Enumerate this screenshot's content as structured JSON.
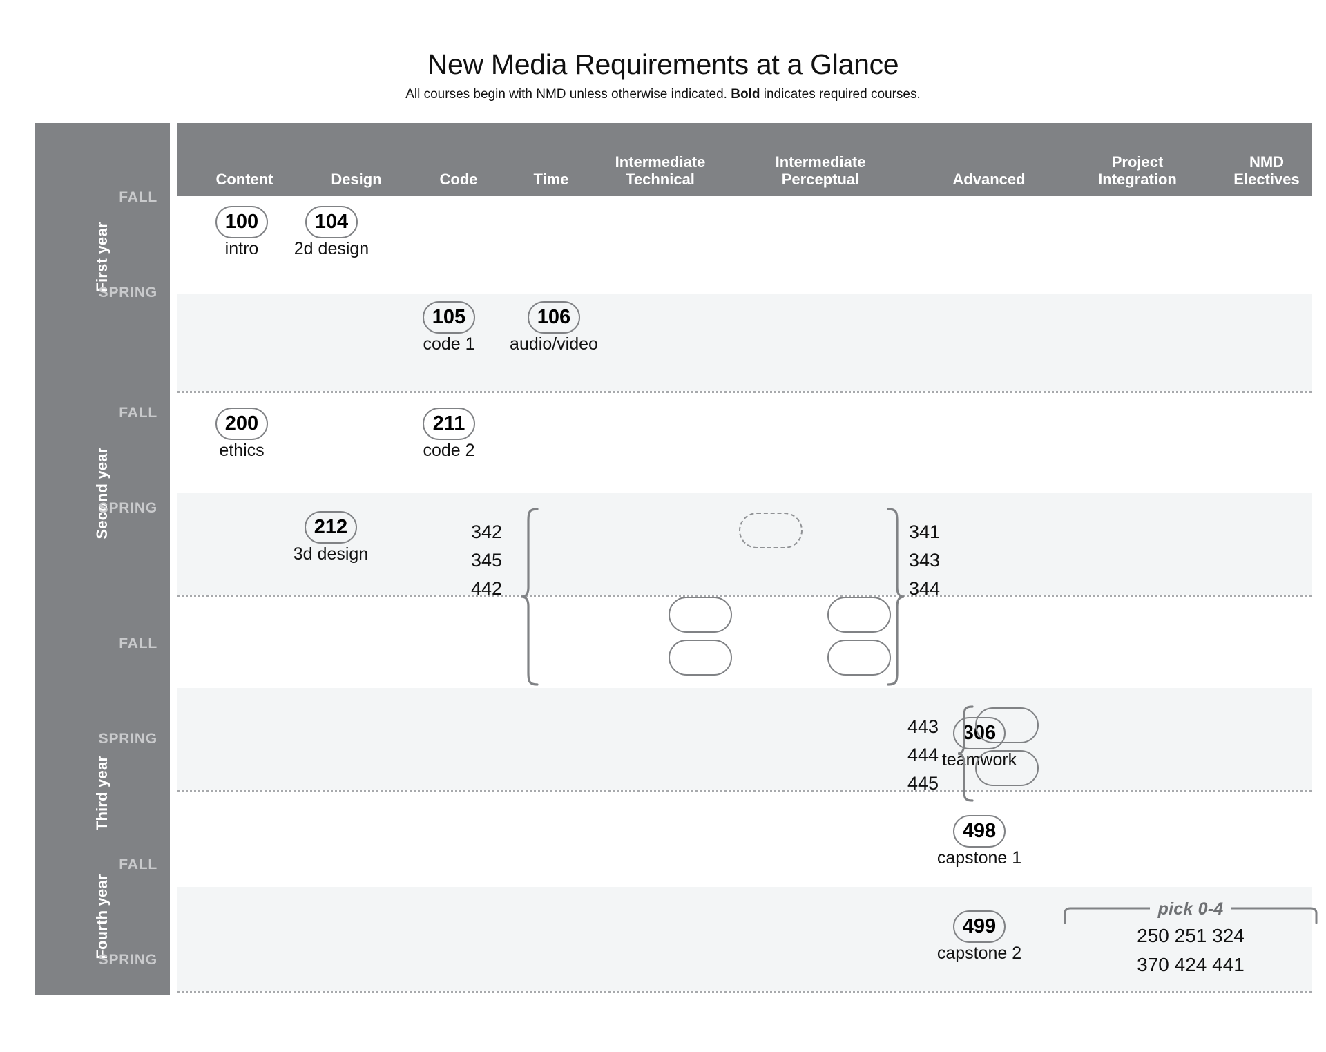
{
  "header": {
    "title": "New Media Requirements at a Glance",
    "subtitle_pre": "All courses begin with NMD unless otherwise indicated. ",
    "subtitle_bold": "Bold",
    "subtitle_post": " indicates required courses."
  },
  "colors": {
    "band_gray": "#808285",
    "alt_row": "#f3f5f6",
    "term_label": "#c9cacc",
    "outline": "#808285"
  },
  "columns": [
    {
      "id": "content",
      "label": "Content"
    },
    {
      "id": "design",
      "label": "Design"
    },
    {
      "id": "code",
      "label": "Code"
    },
    {
      "id": "time",
      "label": "Time"
    },
    {
      "id": "int_tech",
      "label_line1": "Intermediate",
      "label_line2": "Technical"
    },
    {
      "id": "int_perc",
      "label_line1": "Intermediate",
      "label_line2": "Perceptual"
    },
    {
      "id": "advanced",
      "label": "Advanced"
    },
    {
      "id": "proj_int",
      "label_line1": "Project",
      "label_line2": "Integration"
    },
    {
      "id": "electives",
      "label_line1": "NMD",
      "label_line2": "Electives"
    }
  ],
  "years": [
    {
      "id": "y1",
      "label": "First year"
    },
    {
      "id": "y2",
      "label": "Second year"
    },
    {
      "id": "y3",
      "label": "Third year"
    },
    {
      "id": "y4",
      "label": "Fourth year"
    }
  ],
  "terms": {
    "fall": "FALL",
    "spring": "SPRING"
  },
  "courses": [
    {
      "id": "c100",
      "number": "100",
      "name": "intro",
      "column": "content",
      "year": "y1",
      "term": "fall"
    },
    {
      "id": "c104",
      "number": "104",
      "name": "2d design",
      "column": "design",
      "year": "y1",
      "term": "fall"
    },
    {
      "id": "c105",
      "number": "105",
      "name": "code 1",
      "column": "code",
      "year": "y1",
      "term": "spring"
    },
    {
      "id": "c106",
      "number": "106",
      "name": "audio/video",
      "column": "time",
      "year": "y1",
      "term": "spring"
    },
    {
      "id": "c200",
      "number": "200",
      "name": "ethics",
      "column": "content",
      "year": "y2",
      "term": "fall"
    },
    {
      "id": "c211",
      "number": "211",
      "name": "code 2",
      "column": "code",
      "year": "y2",
      "term": "fall"
    },
    {
      "id": "c212",
      "number": "212",
      "name": "3d design",
      "column": "design",
      "year": "y2",
      "term": "spring"
    },
    {
      "id": "c306",
      "number": "306",
      "name": "teamwork",
      "column": "proj_int",
      "year": "y3",
      "term": "spring"
    },
    {
      "id": "c498",
      "number": "498",
      "name": "capstone 1",
      "column": "proj_int",
      "year": "y4",
      "term": "fall"
    },
    {
      "id": "c499",
      "number": "499",
      "name": "capstone 2",
      "column": "proj_int",
      "year": "y4",
      "term": "spring"
    }
  ],
  "choice_groups": [
    {
      "id": "int_tech_group",
      "column": "int_tech",
      "brace_side": "left",
      "options": [
        "342",
        "345",
        "442"
      ],
      "slots": 2,
      "dashed_slot": true
    },
    {
      "id": "int_perc_group",
      "column": "int_perc",
      "brace_side": "right",
      "options": [
        "341",
        "343",
        "344"
      ],
      "slots": 2,
      "dashed_slot": false
    },
    {
      "id": "advanced_group",
      "column": "advanced",
      "brace_side": "left",
      "options": [
        "443",
        "444",
        "445"
      ],
      "slots": 2,
      "dashed_slot": false
    }
  ],
  "electives": {
    "label": "pick 0-4",
    "row1": "250 251 324",
    "row2": "370 424 441"
  }
}
